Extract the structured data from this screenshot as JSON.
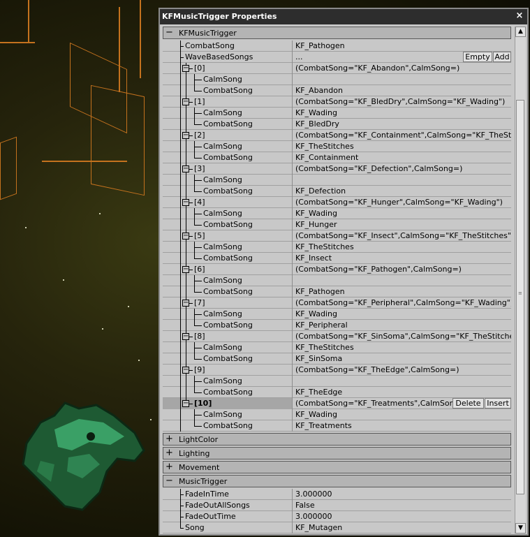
{
  "window": {
    "title": "KFMusicTrigger Properties",
    "close_label": "×"
  },
  "categories": {
    "main": {
      "expander": "−",
      "label": "KFMusicTrigger"
    },
    "light_color": {
      "expander": "+",
      "label": "LightColor"
    },
    "lighting": {
      "expander": "+",
      "label": "Lighting"
    },
    "movement": {
      "expander": "+",
      "label": "Movement"
    },
    "music_trigger": {
      "expander": "−",
      "label": "MusicTrigger"
    }
  },
  "combat_song": {
    "name": "CombatSong",
    "value": "KF_Pathogen"
  },
  "wave_based_songs": {
    "name": "WaveBasedSongs",
    "value": "...",
    "empty_label": "Empty",
    "add_label": "Add"
  },
  "waves": [
    {
      "index": "[0]",
      "summary": "(CombatSong=\"KF_Abandon\",CalmSong=)",
      "calm_label": "CalmSong",
      "calm": "",
      "combat_label": "CombatSong",
      "combat": "KF_Abandon"
    },
    {
      "index": "[1]",
      "summary": "(CombatSong=\"KF_BledDry\",CalmSong=\"KF_Wading\")",
      "calm_label": "CalmSong",
      "calm": "KF_Wading",
      "combat_label": "CombatSong",
      "combat": "KF_BledDry"
    },
    {
      "index": "[2]",
      "summary": "(CombatSong=\"KF_Containment\",CalmSong=\"KF_TheStitches\")",
      "calm_label": "CalmSong",
      "calm": "KF_TheStitches",
      "combat_label": "CombatSong",
      "combat": "KF_Containment"
    },
    {
      "index": "[3]",
      "summary": "(CombatSong=\"KF_Defection\",CalmSong=)",
      "calm_label": "CalmSong",
      "calm": "",
      "combat_label": "CombatSong",
      "combat": "KF_Defection"
    },
    {
      "index": "[4]",
      "summary": "(CombatSong=\"KF_Hunger\",CalmSong=\"KF_Wading\")",
      "calm_label": "CalmSong",
      "calm": "KF_Wading",
      "combat_label": "CombatSong",
      "combat": "KF_Hunger"
    },
    {
      "index": "[5]",
      "summary": "(CombatSong=\"KF_Insect\",CalmSong=\"KF_TheStitches\")",
      "calm_label": "CalmSong",
      "calm": "KF_TheStitches",
      "combat_label": "CombatSong",
      "combat": "KF_Insect"
    },
    {
      "index": "[6]",
      "summary": "(CombatSong=\"KF_Pathogen\",CalmSong=)",
      "calm_label": "CalmSong",
      "calm": "",
      "combat_label": "CombatSong",
      "combat": "KF_Pathogen"
    },
    {
      "index": "[7]",
      "summary": "(CombatSong=\"KF_Peripheral\",CalmSong=\"KF_Wading\")",
      "calm_label": "CalmSong",
      "calm": "KF_Wading",
      "combat_label": "CombatSong",
      "combat": "KF_Peripheral"
    },
    {
      "index": "[8]",
      "summary": "(CombatSong=\"KF_SinSoma\",CalmSong=\"KF_TheStitches\")",
      "calm_label": "CalmSong",
      "calm": "KF_TheStitches",
      "combat_label": "CombatSong",
      "combat": "KF_SinSoma"
    },
    {
      "index": "[9]",
      "summary": "(CombatSong=\"KF_TheEdge\",CalmSong=)",
      "calm_label": "CalmSong",
      "calm": "",
      "combat_label": "CombatSong",
      "combat": "KF_TheEdge"
    },
    {
      "index": "[10]",
      "summary": "(CombatSong=\"KF_Treatments\",CalmSong=\"...",
      "calm_label": "CalmSong",
      "calm": "KF_Wading",
      "combat_label": "CombatSong",
      "combat": "KF_Treatments",
      "delete_label": "Delete",
      "insert_label": "Insert"
    }
  ],
  "music_trigger_props": [
    {
      "name": "FadeInTime",
      "value": "3.000000"
    },
    {
      "name": "FadeOutAllSongs",
      "value": "False"
    },
    {
      "name": "FadeOutTime",
      "value": "3.000000"
    },
    {
      "name": "Song",
      "value": "KF_Mutagen"
    }
  ],
  "scrollbar": {
    "up_arrow": "▲",
    "down_arrow": "▼",
    "grip": "≡"
  },
  "colors": {
    "accent_wire": "#c4721e",
    "window_bg": "#c8c8c8",
    "titlebar_bg": "#2d2d2d"
  }
}
